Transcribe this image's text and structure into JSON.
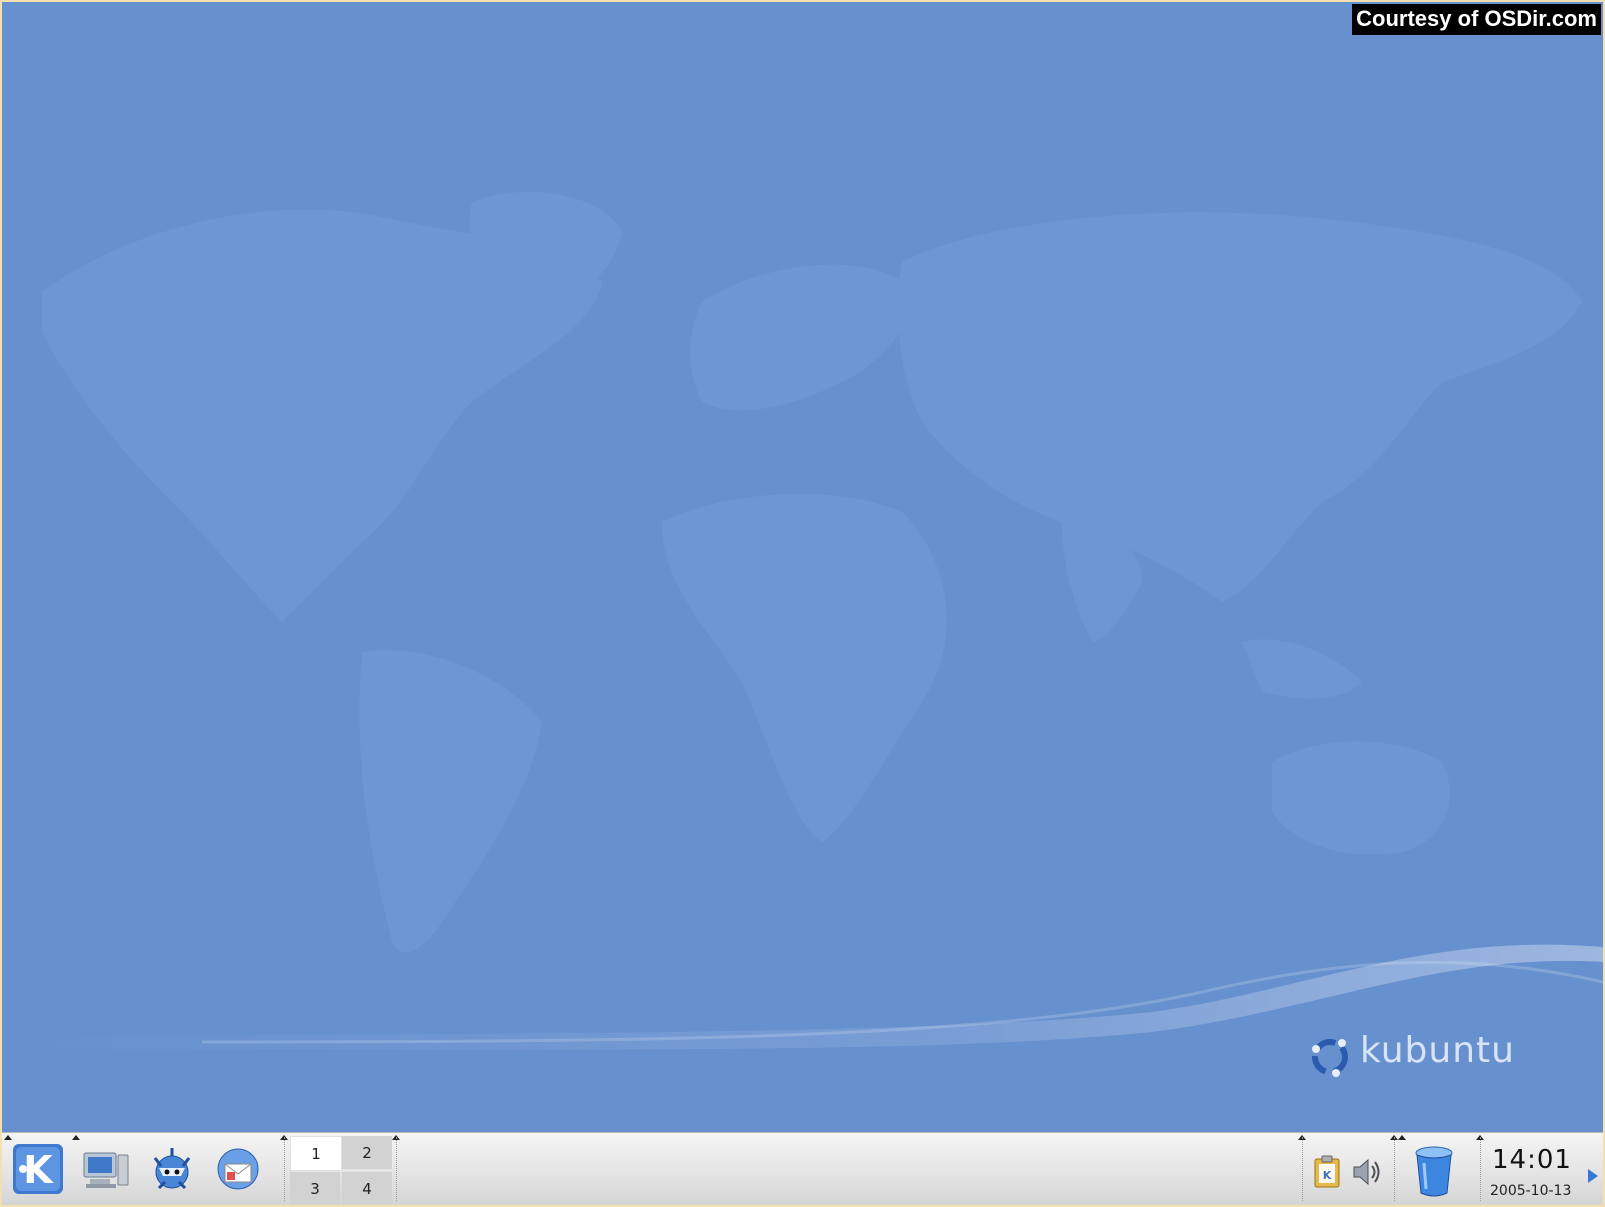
{
  "watermark": "Courtesy of OSDir.com",
  "wallpaper": {
    "brand_text": "kubuntu",
    "base_color": "#6790cf",
    "map_color": "#7199d4"
  },
  "panel": {
    "launchers": [
      {
        "name": "kmenu-button",
        "icon": "kde-k-icon"
      },
      {
        "name": "desktop-access-button",
        "icon": "computer-icon"
      },
      {
        "name": "konqueror-button",
        "icon": "konqueror-icon"
      },
      {
        "name": "kontact-button",
        "icon": "kontact-mail-icon"
      }
    ],
    "pager": {
      "desktops": [
        "1",
        "2",
        "3",
        "4"
      ],
      "active": "1"
    },
    "tray": {
      "klipper_icon": "clipboard-icon",
      "volume_icon": "speaker-icon",
      "trash_icon": "trash-icon"
    },
    "clock": {
      "time": "14:01",
      "date": "2005-10-13"
    }
  }
}
